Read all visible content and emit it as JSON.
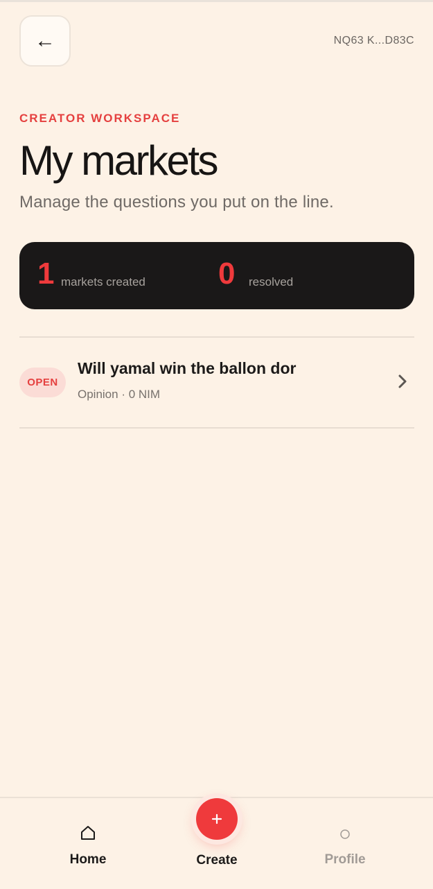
{
  "header": {
    "back_icon": "arrow-left-icon",
    "wallet_address": "NQ63 K...D83C"
  },
  "page": {
    "eyebrow": "CREATOR WORKSPACE",
    "title": "My markets",
    "subtitle": "Manage the questions you put on the line."
  },
  "stats": {
    "created_count": "1",
    "created_label": "markets created",
    "resolved_count": "0",
    "resolved_label": "resolved"
  },
  "markets": [
    {
      "status": "OPEN",
      "title": "Will yamal win the ballon dor",
      "meta": "Opinion · 0 NIM"
    }
  ],
  "nav": {
    "home_label": "Home",
    "create_label": "Create",
    "profile_label": "Profile"
  },
  "colors": {
    "background": "#fdf2e6",
    "accent": "#ef3a3c",
    "dark_card": "#1a1818",
    "badge_bg": "#fbdcd6"
  }
}
